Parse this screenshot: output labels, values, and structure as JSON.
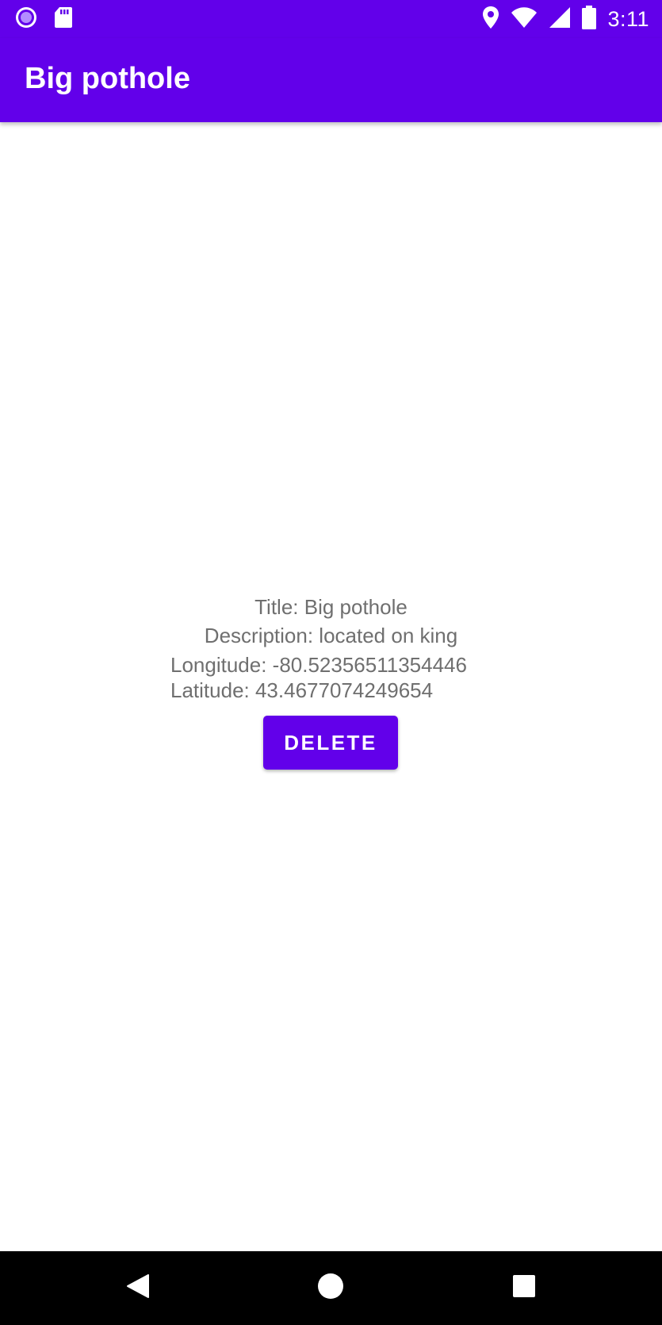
{
  "status_bar": {
    "time": "3:11",
    "left_icons": [
      "record-icon",
      "sd-card-icon"
    ],
    "right_icons": [
      "location-icon",
      "wifi-icon",
      "signal-icon",
      "battery-icon"
    ]
  },
  "app_bar": {
    "title": "Big pothole"
  },
  "details": {
    "title_line": "Title: Big pothole",
    "description_line": "Description: located on king",
    "longitude_line": "Longitude: -80.52356511354446",
    "latitude_line": "Latitude: 43.4677074249654"
  },
  "delete_button": {
    "label": "DELETE"
  },
  "nav_bar": {
    "icons": [
      "back-icon",
      "home-icon",
      "recents-icon"
    ]
  },
  "colors": {
    "primary": "#6200ea",
    "text_secondary": "#6f6f6f",
    "nav_background": "#000000"
  }
}
